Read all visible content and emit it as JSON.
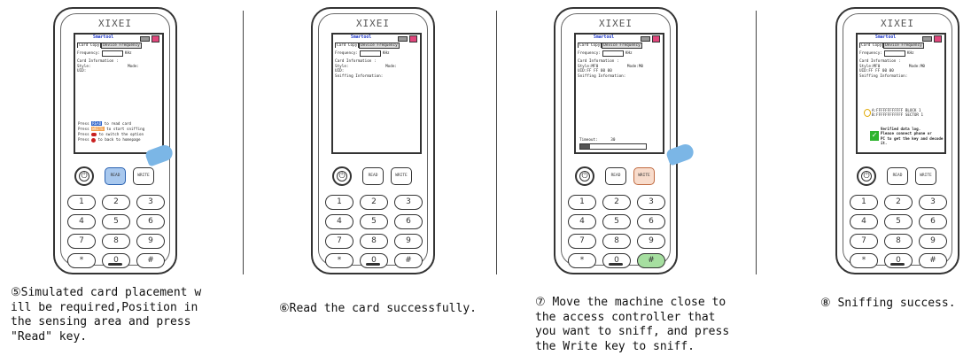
{
  "device": {
    "brand": "XIXEI",
    "app_title": "Smartool",
    "tab_card_copy": "Card Copy",
    "tab_device_freq": "Device Frequency",
    "frequency_label": "Frequency:",
    "frequency_unit": "KHz",
    "card_info_label": "Card Information :",
    "keys": {
      "read": "READ",
      "write": "WRITE",
      "numbers": [
        "1",
        "2",
        "3",
        "4",
        "5",
        "6",
        "7",
        "8",
        "9",
        "*",
        "0",
        "#"
      ]
    }
  },
  "panels": [
    {
      "id": "step5",
      "screen": {
        "row1_left": "Style:",
        "row1_right": "Mode:",
        "row2": "UID:",
        "steps": [
          {
            "pre": "Press ",
            "key": "READ",
            "post": " to read card"
          },
          {
            "pre": "Press ",
            "key": "WRITE",
            "post": " to start sniffing"
          },
          {
            "pre": "Press ",
            "key": "",
            "post": " to switch the option"
          },
          {
            "pre": "Press ",
            "key": "",
            "post": " to back to homepage"
          }
        ]
      },
      "caption": "⑤Simulated card placement w\nill be required,Position in\nthe sensing area and press\n\"Read\" key."
    },
    {
      "id": "step6",
      "screen": {
        "row1_left": "Style:",
        "row1_right": "Mode:",
        "row2": "UID:",
        "row3": "Sniffing Information:"
      },
      "caption": "⑥Read the card successfully."
    },
    {
      "id": "step7",
      "screen": {
        "row1_left": "Style:MF0",
        "row1_right": "Mode:M0",
        "row2": "UID:FF FF 00 00",
        "row3": "Sniffing Information:",
        "timeout_label": "Timeout:",
        "timeout_value": "30",
        "progress": 0.15
      },
      "caption": "⑦ Move the machine close to\nthe access controller that\nyou want to sniff, and press\nthe Write key to sniff."
    },
    {
      "id": "step8",
      "screen": {
        "row1_left": "Style:MF0",
        "row1_right": "Mode:M0",
        "row2": "UID:FF FF 00 00",
        "row3": "Sniffing Information:",
        "log_lines": [
          "A:FFFFFFFFFFFF  BLOCK 1",
          "B:FFFFFFFFFFFF  SECTOR 1"
        ],
        "success_lines": [
          "Verified data log.",
          "Please connect phone or",
          "PC to get the key and decode it."
        ]
      },
      "caption": "⑧ Sniffing success."
    }
  ],
  "colors": {
    "title_blue": "#1e37c8",
    "close_pink": "#e0457b",
    "finger_blue": "#7bb6e6",
    "success_green": "#2fb42f",
    "highlight_blue": "#2a60c8",
    "highlight_orange": "#f3a250"
  }
}
